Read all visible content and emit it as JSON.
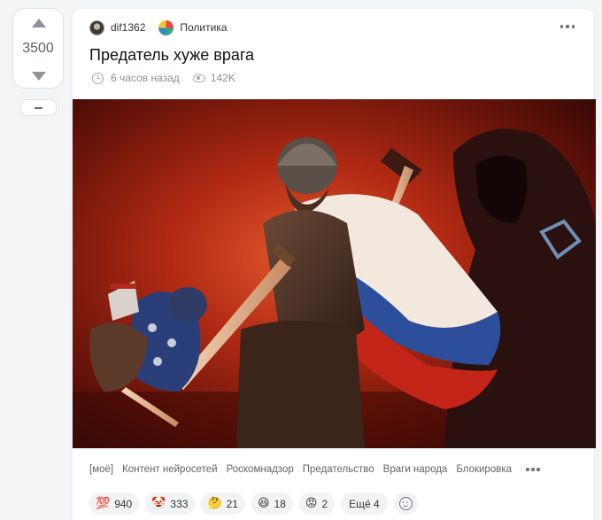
{
  "votes": {
    "count": "3500"
  },
  "post": {
    "author": "dif1362",
    "community": "Политика",
    "title": "Предатель хуже врага",
    "time": "6 часов назад",
    "views": "142K",
    "image_icon": "illustration-knight-vs-traitor"
  },
  "tags": [
    "[моё]",
    "Контент нейросетей",
    "Роскомнадзор",
    "Предательство",
    "Враги народа",
    "Блокировка"
  ],
  "reactions": [
    {
      "emoji": "💯",
      "count": "940",
      "icon": "hundred-points-icon"
    },
    {
      "emoji": "🤡",
      "count": "333",
      "icon": "clown-face-icon"
    },
    {
      "emoji": "🤔",
      "count": "21",
      "icon": "thinking-face-icon"
    },
    {
      "emoji": "😆",
      "count": "18",
      "icon": "laughing-face-icon"
    },
    {
      "emoji": "😡",
      "count": "2",
      "icon": "angry-face-icon"
    }
  ],
  "reactions_more": "Ещё 4"
}
